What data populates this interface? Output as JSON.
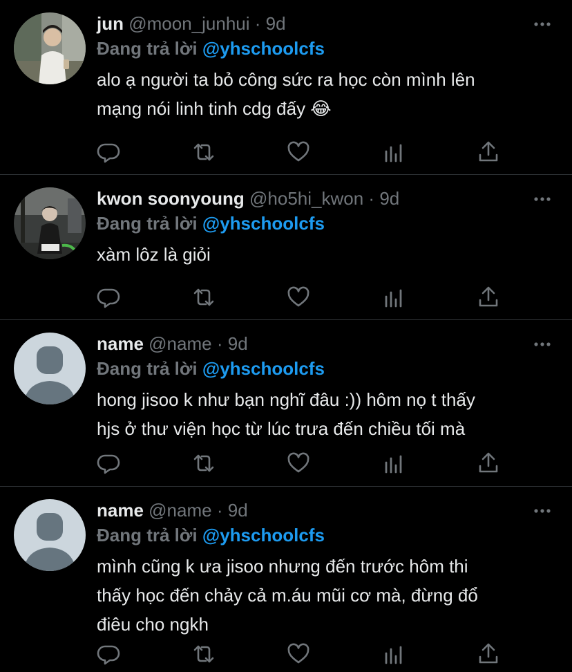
{
  "tweets": [
    {
      "name": "jun",
      "handle": "@moon_junhui",
      "dot": "·",
      "time": "9d",
      "reply_prefix": "Đang trả lời",
      "reply_to": "@yhschoolcfs",
      "text": "alo ạ người ta bỏ công sức ra học còn mình lên\nmạng nói linh tinh cdg đấy 😂",
      "avatar": "photo-avatar"
    },
    {
      "name": "kwon soonyoung",
      "handle": "@ho5hi_kwon",
      "dot": "·",
      "time": "9d",
      "reply_prefix": "Đang trả lời",
      "reply_to": "@yhschoolcfs",
      "text": "xàm lôz là giỏi",
      "avatar": "photo-avatar"
    },
    {
      "name": "name",
      "handle": "@name",
      "dot": "·",
      "time": "9d",
      "reply_prefix": "Đang trả lời",
      "reply_to": "@yhschoolcfs",
      "text": "hong jisoo k như bạn nghĩ đâu :)) hôm nọ t thấy\nhjs ở thư viện học từ lúc trưa đến chiều tối mà",
      "avatar": "default-avatar"
    },
    {
      "name": "name",
      "handle": "@name",
      "dot": "·",
      "time": "9d",
      "reply_prefix": "Đang trả lời",
      "reply_to": "@yhschoolcfs",
      "text": "mình cũng k ưa jisoo nhưng đến trước hôm thi\nthấy học đến chảy cả m.áu mũi cơ mà, đừng đổ\nđiêu cho ngkh",
      "avatar": "default-avatar"
    }
  ],
  "action_icons": [
    "reply-icon",
    "retweet-icon",
    "like-icon",
    "analytics-icon",
    "share-icon"
  ],
  "colors": {
    "background": "#000000",
    "text": "#e7e9ea",
    "muted": "#71767b",
    "accent": "#1d9bf0",
    "divider": "#2f3336"
  }
}
